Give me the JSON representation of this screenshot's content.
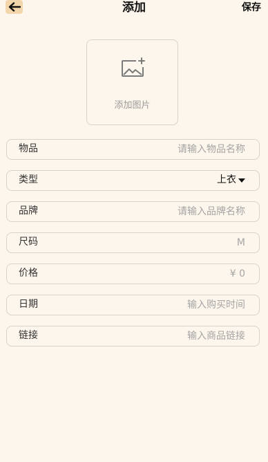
{
  "header": {
    "back_icon": "arrow-left-icon",
    "title": "添加",
    "save_label": "保存"
  },
  "image_upload": {
    "icon": "add-image-icon",
    "label": "添加图片"
  },
  "fields": [
    {
      "key": "name",
      "label": "物品",
      "value": "",
      "placeholder": "请输入物品名称"
    },
    {
      "key": "type",
      "label": "类型",
      "value": "上衣",
      "type": "select"
    },
    {
      "key": "brand",
      "label": "品牌",
      "value": "",
      "placeholder": "请输入品牌名称"
    },
    {
      "key": "size",
      "label": "尺码",
      "value": "",
      "placeholder": "M"
    },
    {
      "key": "price",
      "label": "价格",
      "value": "",
      "placeholder": "¥ 0"
    },
    {
      "key": "date",
      "label": "日期",
      "value": "",
      "placeholder": "输入购买时间"
    },
    {
      "key": "link",
      "label": "链接",
      "value": "",
      "placeholder": "输入商品链接"
    }
  ],
  "colors": {
    "background": "#fdf6ec",
    "back_button": "#f3d6ab",
    "border": "#d9d2c7",
    "placeholder": "#a5a5a5"
  }
}
